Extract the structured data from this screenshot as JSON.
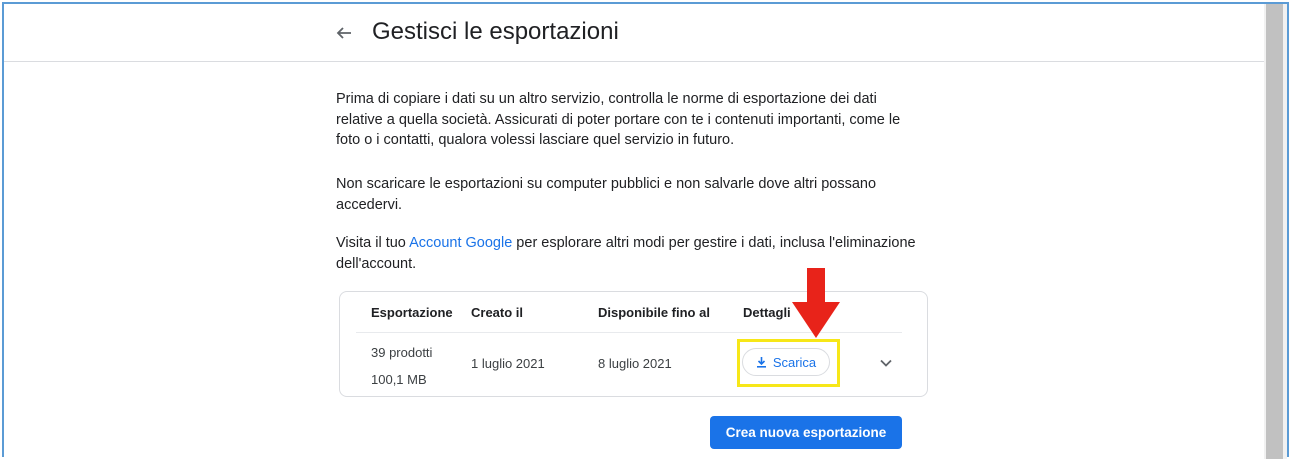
{
  "header": {
    "title": "Gestisci le esportazioni"
  },
  "intro": {
    "paragraph1": "Prima di copiare i dati su un altro servizio, controlla le norme di esportazione dei dati relative a quella società. Assicurati di poter portare con te i contenuti importanti, come le foto o i contatti, qualora volessi lasciare quel servizio in futuro.",
    "paragraph2": "Non scaricare le esportazioni su computer pubblici e non salvarle dove altri possano accedervi.",
    "paragraph3_before": "Visita il tuo ",
    "paragraph3_link": "Account Google",
    "paragraph3_after": " per esplorare altri modi per gestire i dati, inclusa l'eliminazione dell'account."
  },
  "table": {
    "columns": [
      "Esportazione",
      "Creato il",
      "Disponibile fino al",
      "Dettagli"
    ],
    "rows": [
      {
        "name": "39 prodotti",
        "size": "100,1 MB",
        "created": "1 luglio 2021",
        "available_until": "8 luglio 2021",
        "action_label": "Scarica"
      }
    ]
  },
  "actions": {
    "create_label": "Crea nuova esportazione"
  },
  "colors": {
    "accent": "#1a73e8",
    "highlight": "#f7e718",
    "arrow": "#e8231a"
  }
}
